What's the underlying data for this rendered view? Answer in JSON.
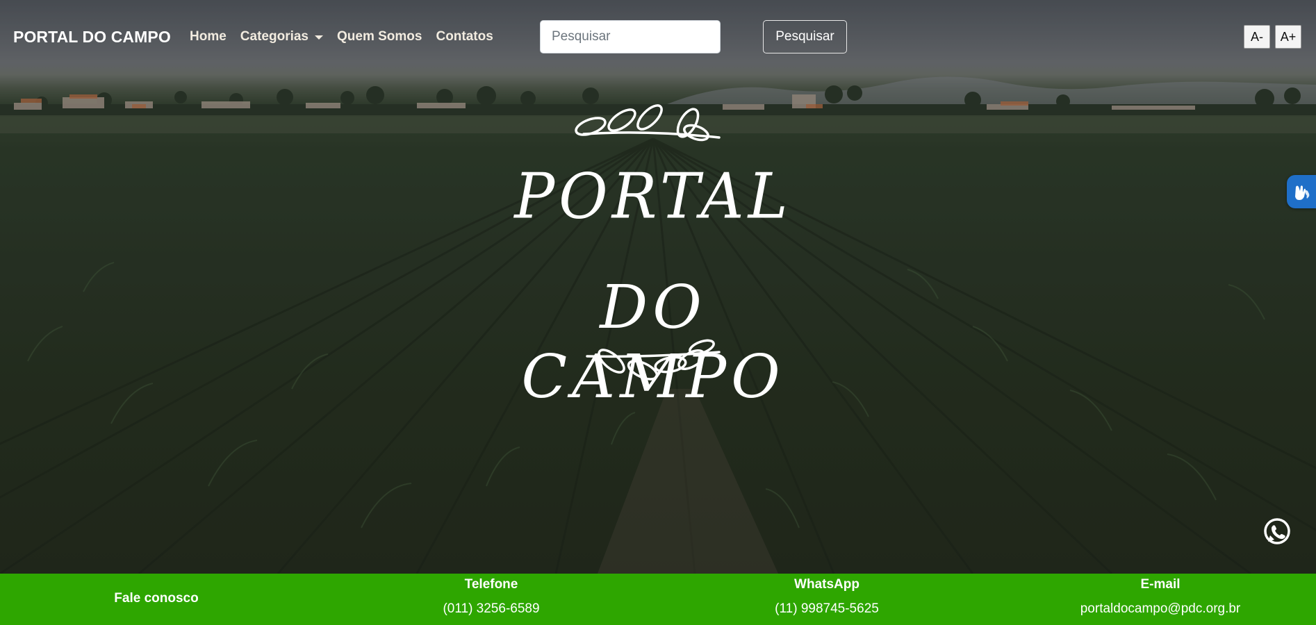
{
  "navbar": {
    "brand": "PORTAL DO CAMPO",
    "links": [
      {
        "label": "Home"
      },
      {
        "label": "Categorias",
        "has_dropdown": true
      },
      {
        "label": "Quem Somos"
      },
      {
        "label": "Contatos"
      }
    ],
    "search": {
      "placeholder": "Pesquisar",
      "value": "",
      "button_label": "Pesquisar"
    },
    "font_controls": {
      "decrease_label": "A-",
      "increase_label": "A+"
    }
  },
  "hero": {
    "logo_line1": "PORTAL",
    "logo_line2": "DO CAMPO"
  },
  "footer": {
    "contact_heading": "Fale conosco",
    "phone": {
      "title": "Telefone",
      "value": "(011) 3256-6589"
    },
    "whatsapp": {
      "title": "WhatsApp",
      "value": "(11) 998745-5625"
    },
    "email": {
      "title": "E-mail",
      "value": "portaldocampo@pdc.org.br"
    }
  },
  "colors": {
    "footer_bg": "#2ea600",
    "accessibility_tab": "#1f6fc8",
    "whatsapp_icon": "#ffffff"
  },
  "icons": {
    "accessibility": "sign-language-hands-icon",
    "whatsapp": "whatsapp-icon",
    "dropdown": "caret-down-icon",
    "laurel": "laurel-branch-icon"
  }
}
